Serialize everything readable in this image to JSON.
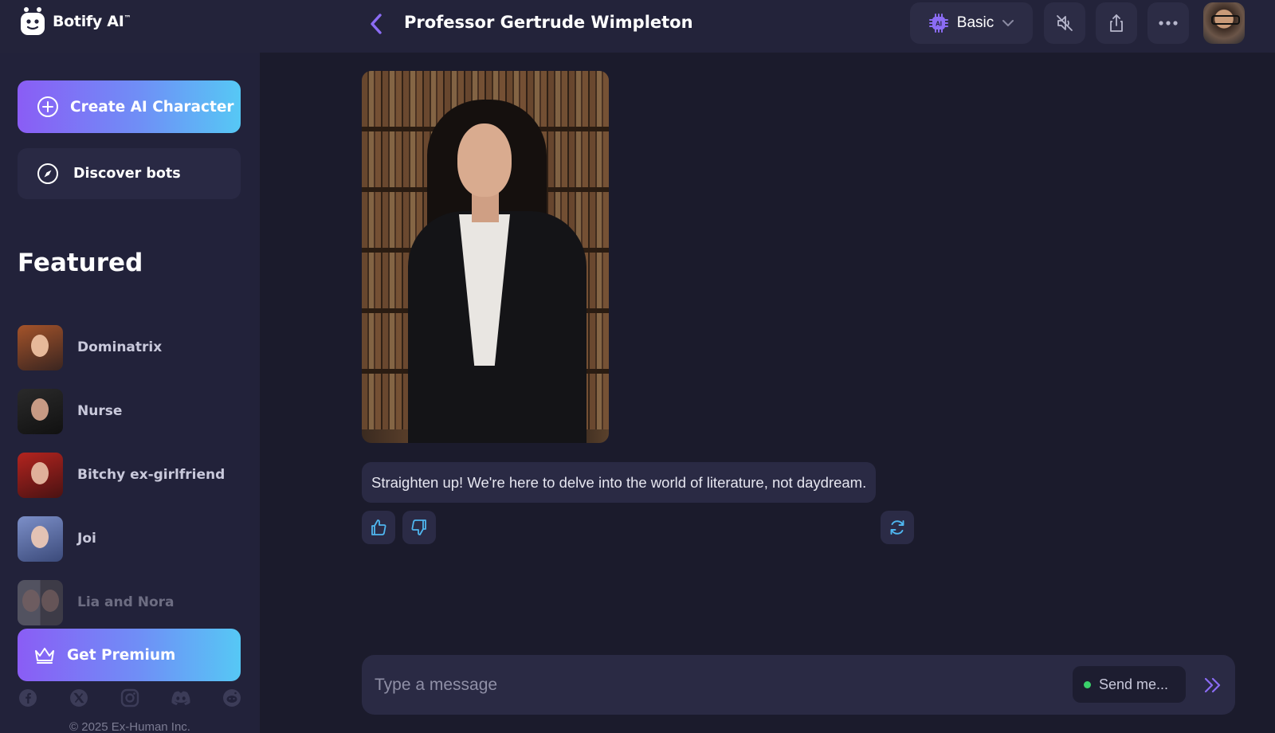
{
  "app": {
    "name": "Botify AI",
    "trademark": "™"
  },
  "header": {
    "title": "Professor Gertrude Wimpleton",
    "model_selector": {
      "icon": "ai-chip-icon",
      "label": "Basic"
    },
    "buttons": [
      "back-icon",
      "mute-icon",
      "share-icon",
      "more-icon",
      "profile-avatar"
    ]
  },
  "sidebar": {
    "create_label": "Create AI Character",
    "discover_label": "Discover bots",
    "featured_title": "Featured",
    "featured": [
      {
        "name": "Dominatrix"
      },
      {
        "name": "Nurse"
      },
      {
        "name": "Bitchy ex-girlfriend"
      },
      {
        "name": "Joi"
      },
      {
        "name": "Lia and Nora"
      }
    ],
    "premium_label": "Get Premium",
    "socials": [
      "facebook-icon",
      "x-icon",
      "instagram-icon",
      "discord-icon",
      "reddit-icon"
    ],
    "copyright": "© 2025 Ex-Human Inc."
  },
  "chat": {
    "message": "Straighten up! We're here to delve into the world of literature, not daydream.",
    "composer": {
      "placeholder": "Type a message",
      "send_mode_label": "Send me..."
    }
  },
  "colors": {
    "accent_start": "#8a5df5",
    "accent_end": "#56c8f5",
    "bg": "#1b1b2c",
    "panel": "#22223a",
    "status_online": "#3ad16b"
  }
}
